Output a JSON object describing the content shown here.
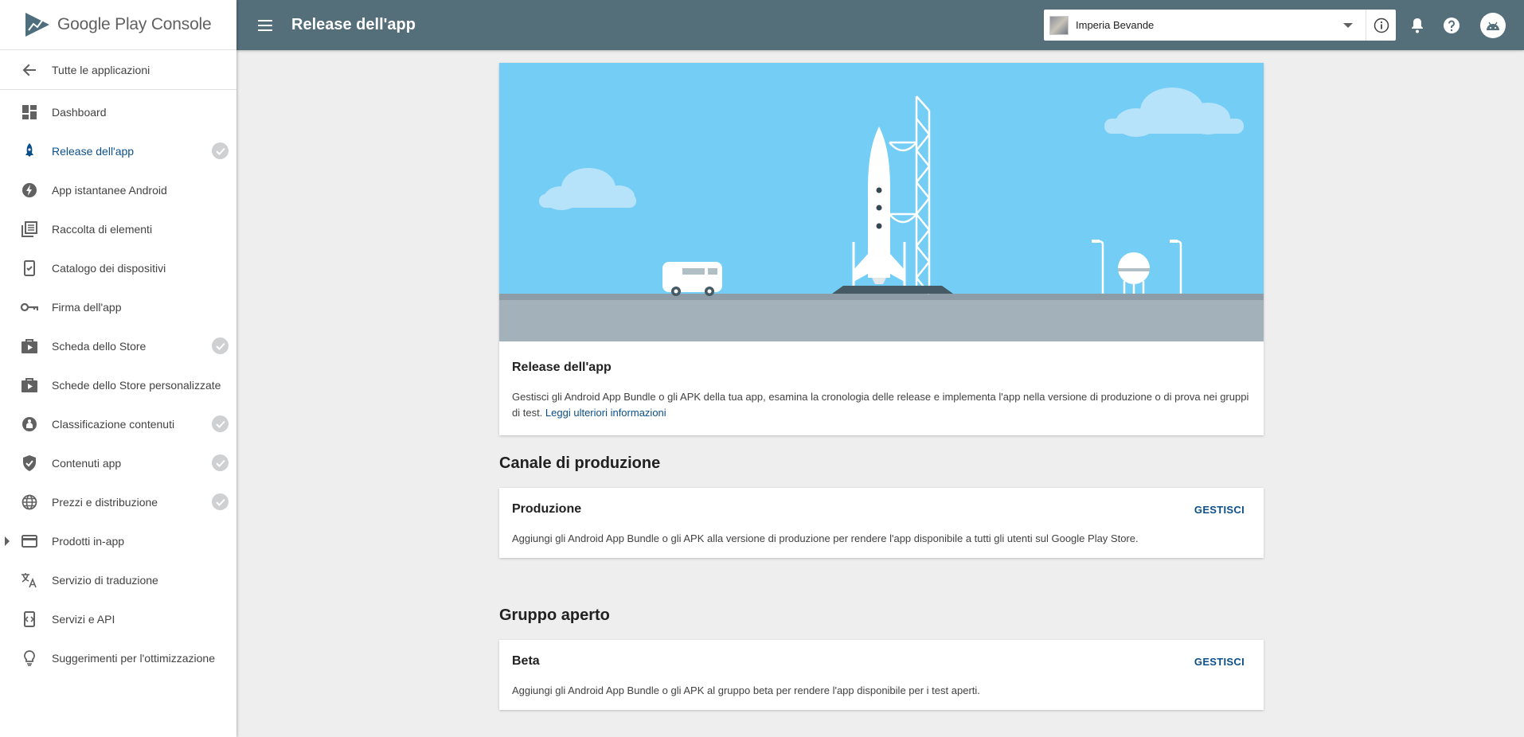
{
  "brand": {
    "google": "Google Play",
    "console": "Console"
  },
  "sidebar": {
    "back_label": "Tutte le applicazioni",
    "items": [
      {
        "label": "Dashboard",
        "icon": "dashboard-icon",
        "active": false,
        "checked": false
      },
      {
        "label": "Release dell'app",
        "icon": "rocket-icon",
        "active": true,
        "checked": true
      },
      {
        "label": "App istantanee Android",
        "icon": "bolt-icon",
        "active": false,
        "checked": false
      },
      {
        "label": "Raccolta di elementi",
        "icon": "library-icon",
        "active": false,
        "checked": false
      },
      {
        "label": "Catalogo dei dispositivi",
        "icon": "device-check-icon",
        "active": false,
        "checked": false
      },
      {
        "label": "Firma dell'app",
        "icon": "key-icon",
        "active": false,
        "checked": false
      },
      {
        "label": "Scheda dello Store",
        "icon": "store-icon",
        "active": false,
        "checked": true
      },
      {
        "label": "Schede dello Store personalizzate",
        "icon": "store-icon",
        "active": false,
        "checked": false
      },
      {
        "label": "Classificazione contenuti",
        "icon": "rating-icon",
        "active": false,
        "checked": true
      },
      {
        "label": "Contenuti app",
        "icon": "shield-icon",
        "active": false,
        "checked": true
      },
      {
        "label": "Prezzi e distribuzione",
        "icon": "globe-icon",
        "active": false,
        "checked": true
      },
      {
        "label": "Prodotti in-app",
        "icon": "card-icon",
        "active": false,
        "checked": false,
        "expandable": true
      },
      {
        "label": "Servizio di traduzione",
        "icon": "translate-icon",
        "active": false,
        "checked": false
      },
      {
        "label": "Servizi e API",
        "icon": "api-icon",
        "active": false,
        "checked": false
      },
      {
        "label": "Suggerimenti per l'ottimizzazione",
        "icon": "lightbulb-icon",
        "active": false,
        "checked": false
      }
    ]
  },
  "header": {
    "title": "Release dell'app",
    "app_name": "Imperia Bevande"
  },
  "intro": {
    "title": "Release dell'app",
    "text": "Gestisci gli Android App Bundle o gli APK della tua app, esamina la cronologia delle release e implementa l'app nella versione di produzione o di prova nei gruppi di test.",
    "link": "Leggi ulteriori informazioni"
  },
  "sections": [
    {
      "heading": "Canale di produzione",
      "track_title": "Produzione",
      "action": "GESTISCI",
      "desc": "Aggiungi gli Android App Bundle o gli APK alla versione di produzione per rendere l'app disponibile a tutti gli utenti sul Google Play Store."
    },
    {
      "heading": "Gruppo aperto",
      "track_title": "Beta",
      "action": "GESTISCI",
      "desc": "Aggiungi gli Android App Bundle o gli APK al gruppo beta per rendere l'app disponibile per i test aperti."
    }
  ],
  "colors": {
    "topbar": "#546e7a",
    "accent": "#0b4f8a",
    "sky": "#74cdf5"
  }
}
